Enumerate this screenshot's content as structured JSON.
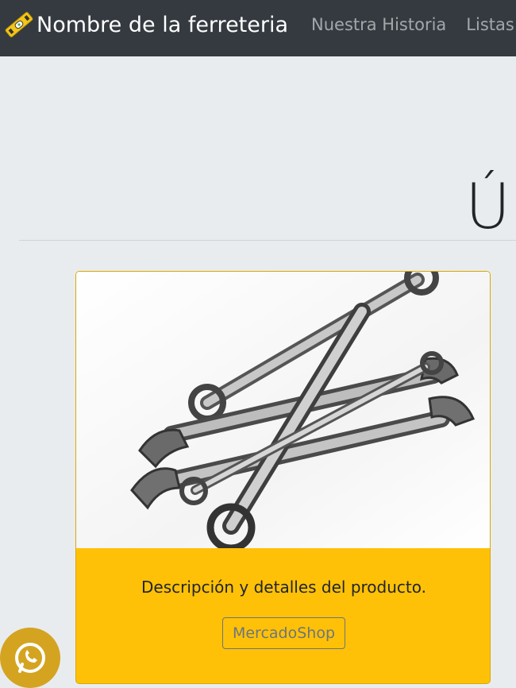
{
  "navbar": {
    "brand": "Nombre de la ferreteria",
    "links": [
      "Nuestra Historia",
      "Listas"
    ]
  },
  "hero": {
    "title": "Ú"
  },
  "card": {
    "image_icon": "wrenches-photo",
    "text": "Descripción y detalles del producto.",
    "button_label": "MercadoShop"
  },
  "floating": {
    "icon": "whatsapp-icon"
  },
  "colors": {
    "navbar": "#343a40",
    "background": "#e9ecef",
    "card": "#ffc107",
    "whatsapp": "#d4a420"
  }
}
